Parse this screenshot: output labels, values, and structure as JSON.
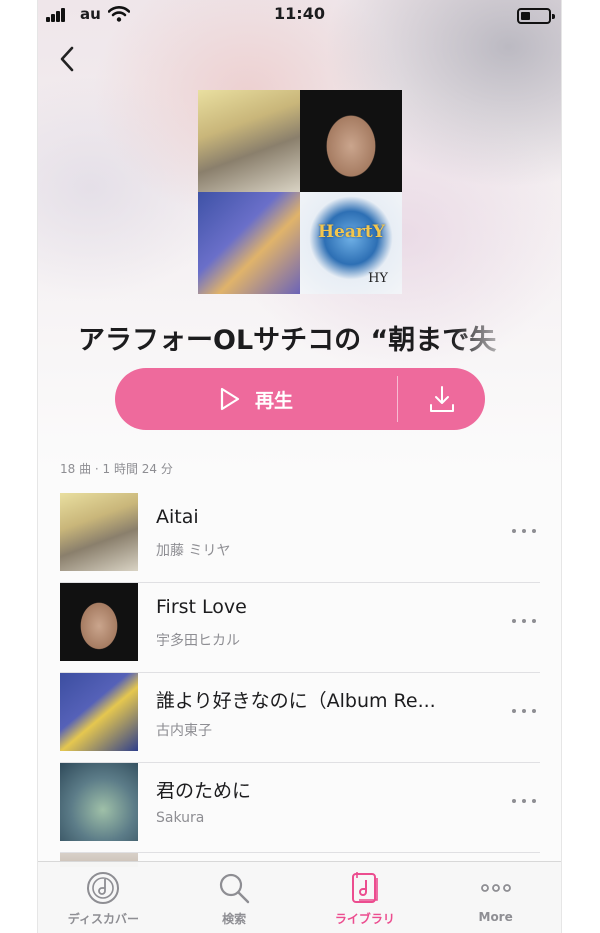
{
  "status_bar": {
    "carrier": "au",
    "time": "11:40",
    "icons": [
      "signal-icon",
      "wifi-icon",
      "battery-icon"
    ]
  },
  "header": {
    "back_icon": "chevron-left-icon"
  },
  "playlist": {
    "title": "アラフォーOLサチコの “朝まで失",
    "artwork_hy_text": "HY",
    "artwork_hearty_text": "HeartY",
    "play_label": "再生",
    "play_icon": "play-icon",
    "download_icon": "download-icon",
    "summary": "18 曲 · 1 時間 24 分"
  },
  "tracks": [
    {
      "title": "Aitai",
      "artist": "加藤 ミリヤ"
    },
    {
      "title": "First Love",
      "artist": "宇多田ヒカル"
    },
    {
      "title": "誰より好きなのに（Album Re...",
      "artist": "古内東子"
    },
    {
      "title": "君のために",
      "artist": "Sakura"
    }
  ],
  "tab_bar": {
    "items": [
      {
        "label": "ディスカバー",
        "icon": "discover-icon",
        "active": false
      },
      {
        "label": "検索",
        "icon": "search-icon",
        "active": false
      },
      {
        "label": "ライブラリ",
        "icon": "library-icon",
        "active": true
      },
      {
        "label": "More",
        "icon": "more-icon",
        "active": false
      }
    ]
  },
  "colors": {
    "accent": "#ee6a9c",
    "tab_active": "#ec4d8f",
    "secondary_text": "#8e8e93"
  }
}
